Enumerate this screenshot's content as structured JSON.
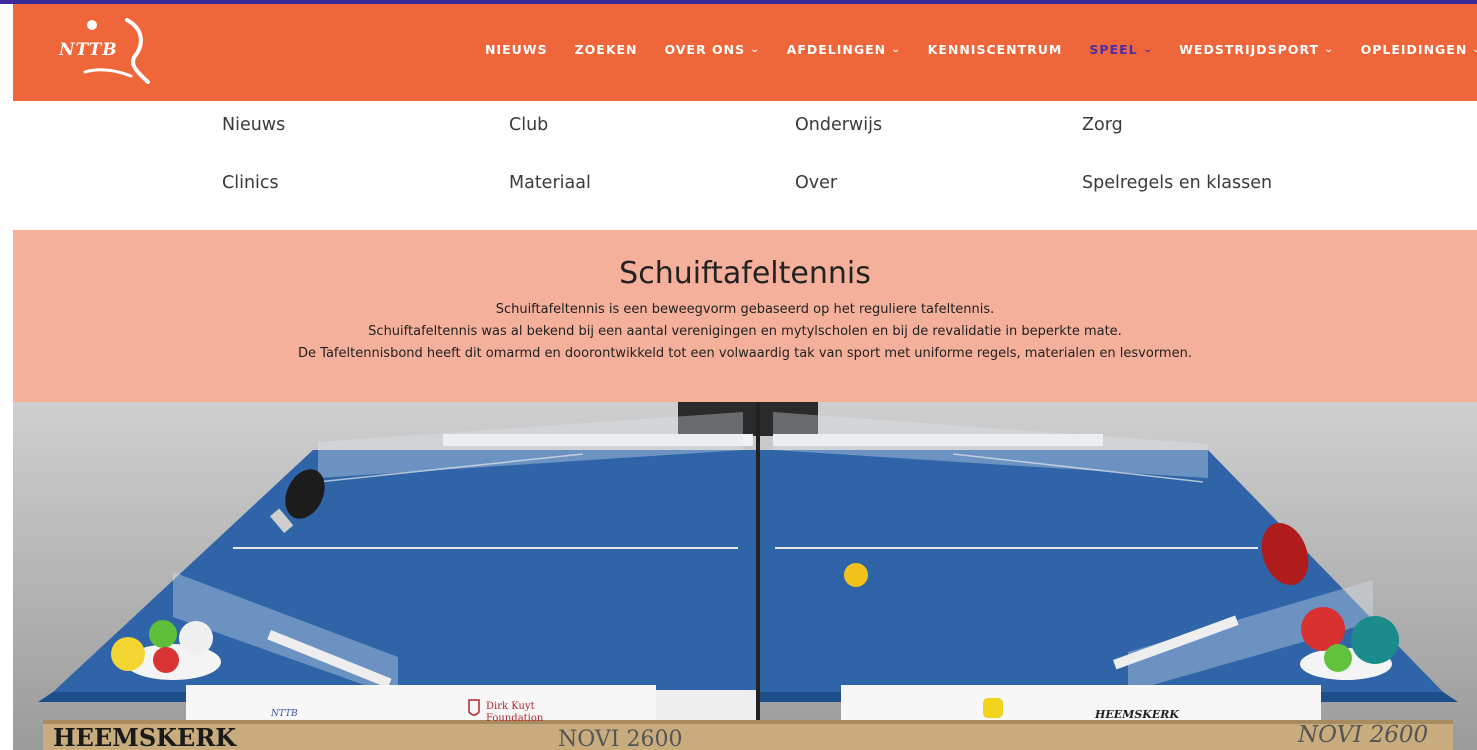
{
  "brand": {
    "logo_text": "NTTB"
  },
  "nav": {
    "items": [
      {
        "label": "NIEUWS",
        "has_dropdown": false
      },
      {
        "label": "ZOEKEN",
        "has_dropdown": false
      },
      {
        "label": "OVER ONS",
        "has_dropdown": true
      },
      {
        "label": "AFDELINGEN",
        "has_dropdown": true
      },
      {
        "label": "KENNISCENTRUM",
        "has_dropdown": false
      },
      {
        "label": "SPEEL",
        "has_dropdown": true,
        "active": true
      },
      {
        "label": "WEDSTRIJDSPORT",
        "has_dropdown": true
      },
      {
        "label": "OPLEIDINGEN",
        "has_dropdown": true
      }
    ]
  },
  "dropdown": {
    "items": [
      "Nieuws",
      "Club",
      "Onderwijs",
      "Zorg",
      "Clinics",
      "Materiaal",
      "Over",
      "Spelregels en klassen"
    ]
  },
  "hero": {
    "title": "Schuiftafeltennis",
    "lines": [
      "Schuiftafeltennis is een beweegvorm gebaseerd op het reguliere tafeltennis.",
      "Schuiftafeltennis was al bekend bij een aantal verenigingen en mytylscholen en bij de revalidatie in beperkte mate.",
      "De Tafeltennisbond heeft dit omarmd en doorontwikkeld tot een volwaardig tak van sport met uniforme regels, materialen en lesvormen."
    ]
  },
  "photo": {
    "table_left_brand": "HEEMSKERK",
    "table_right_model": "NOVI 2600",
    "left_model_partial": "NOVI 2600",
    "sponsor": "Dirk Kuyt Foundation",
    "sponsor_line1": "Dirk Kuyt",
    "sponsor_line2": "Foundation",
    "right_brand": "HEEMSKERK",
    "panel_logo": "NTTB"
  },
  "colors": {
    "header": "#ef663a",
    "hero_bg": "#f4b09b",
    "active_nav": "#4b2ea5",
    "table_blue": "#2f65a8"
  }
}
